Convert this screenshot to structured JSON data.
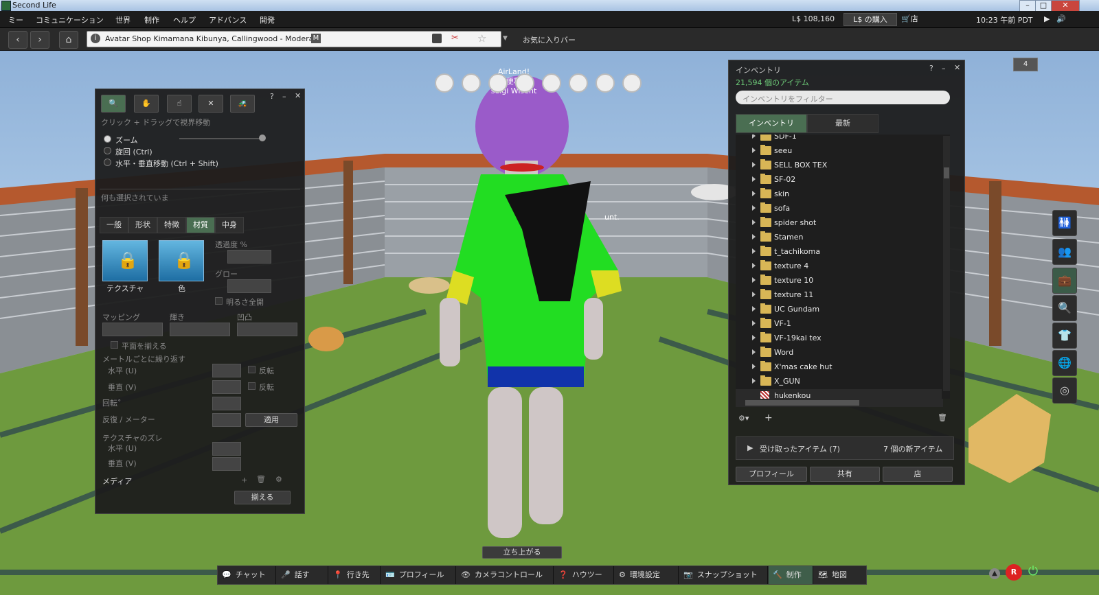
{
  "window": {
    "title": "Second Life"
  },
  "menu": {
    "items": [
      "ミー",
      "コミュニケーション",
      "世界",
      "制作",
      "ヘルプ",
      "アドバンス",
      "開発"
    ],
    "balance": "L$ 108,160",
    "buy_label": "L$ の購入",
    "shop_label": "店",
    "time": "10:23 午前 PDT"
  },
  "nav": {
    "location": "Avatar Shop Kimamana Kibunya, Callingwood - Moderate",
    "maturity_badge": "M",
    "favorites_label": "お気に入りバー"
  },
  "scene": {
    "nametag_lines": [
      "AirLand!",
      "S 便利屋",
      "seigi Wisent"
    ],
    "stand_up_label": "立ち上がる",
    "side_text": "unt.",
    "corner_badge": "4"
  },
  "build_panel": {
    "hint": "クリック + ドラッグで視界移動",
    "radio": [
      "ズーム",
      "旋回 (Ctrl)",
      "水平・垂直移動 (Ctrl + Shift)"
    ],
    "nothing_selected": "何も選択されていま",
    "tabs": [
      "一般",
      "形状",
      "特徴",
      "材質",
      "中身"
    ],
    "selected_tab": "材質",
    "texture_label": "テクスチャ",
    "color_label": "色",
    "transparency_label": "透過度 %",
    "glow_label": "グロー",
    "fullbright_label": "明るさ全開",
    "mapping_label": "マッピング",
    "shininess_label": "輝き",
    "bumpiness_label": "凹凸",
    "align_planar_label": "平面を揃える",
    "repeats_per_meter_label": "メートルごとに繰り返す",
    "horizontal_label": "水平 (U)",
    "vertical_label": "垂直 (V)",
    "flip_label": "反転",
    "rotation_label": "回転˚",
    "repeats_label": "反復 / メーター",
    "apply_label": "適用",
    "offset_label": "テクスチャのズレ",
    "offset_h_label": "水平 (U)",
    "offset_v_label": "垂直 (V)",
    "media_label": "メディア",
    "align_label": "揃える"
  },
  "inventory": {
    "title": "インベントリ",
    "count": "21,594 個のアイテム",
    "filter_placeholder": "インベントリをフィルター",
    "tabs": [
      "インベントリ",
      "最新"
    ],
    "partial_top": "SDF-1",
    "folders": [
      "seeu",
      "SELL BOX TEX",
      "SF-02",
      "skin",
      "sofa",
      "spider shot",
      "Stamen",
      "t_tachikoma",
      "texture 4",
      "texture 10",
      "texture 11",
      "UC Gundam",
      "VF-1",
      "VF-19kai tex",
      "Word",
      "X'mas cake hut",
      "X_GUN"
    ],
    "last_item": "hukenkou",
    "received_label": "受け取ったアイテム (7)",
    "new_items": "7 個の新アイテム",
    "buttons": [
      "プロフィール",
      "共有",
      "店"
    ]
  },
  "toolbar": {
    "buttons": [
      "チャット",
      "話す",
      "行き先",
      "プロフィール",
      "カメラコントロール",
      "ハウツー",
      "環境設定",
      "スナップショット",
      "制作",
      "地図"
    ]
  }
}
